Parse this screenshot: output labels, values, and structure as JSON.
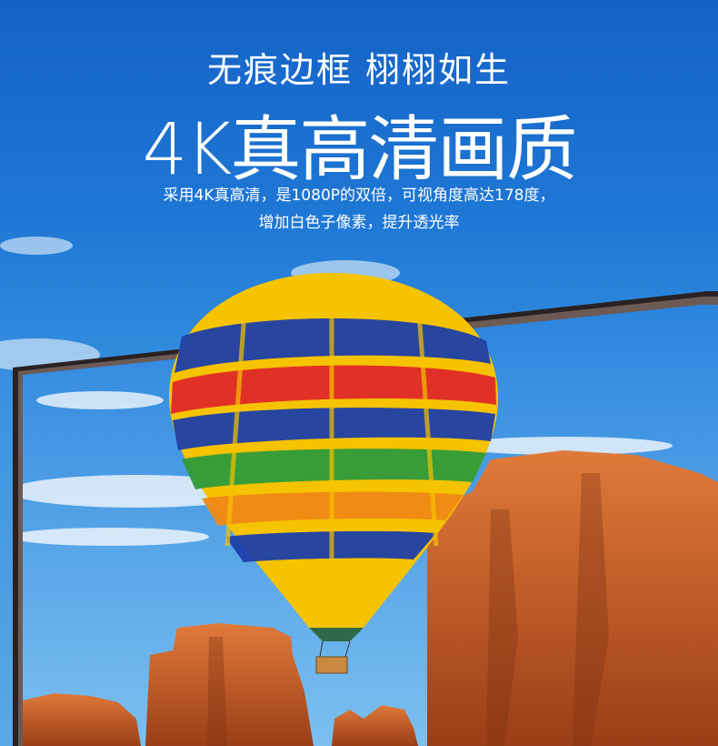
{
  "headline": "无痕边框 栩栩如生",
  "title": "4K真高清画质",
  "desc_line1": "采用4K真高清，是1080P的双倍，可视角度高达178度，",
  "desc_line2": "增加白色子像素，提升透光率",
  "colors": {
    "sky_top": "#1462c6",
    "sky_bottom": "#5aa8e6",
    "tv_frame": "#3a2e2e",
    "balloon_yellow": "#f6c300",
    "balloon_blue": "#1d3fa8",
    "balloon_red": "#e02a2a",
    "rock": "#c65a22"
  },
  "icons": [
    "tv-frame-icon",
    "hot-air-balloon-icon",
    "rock-formation-icon"
  ]
}
